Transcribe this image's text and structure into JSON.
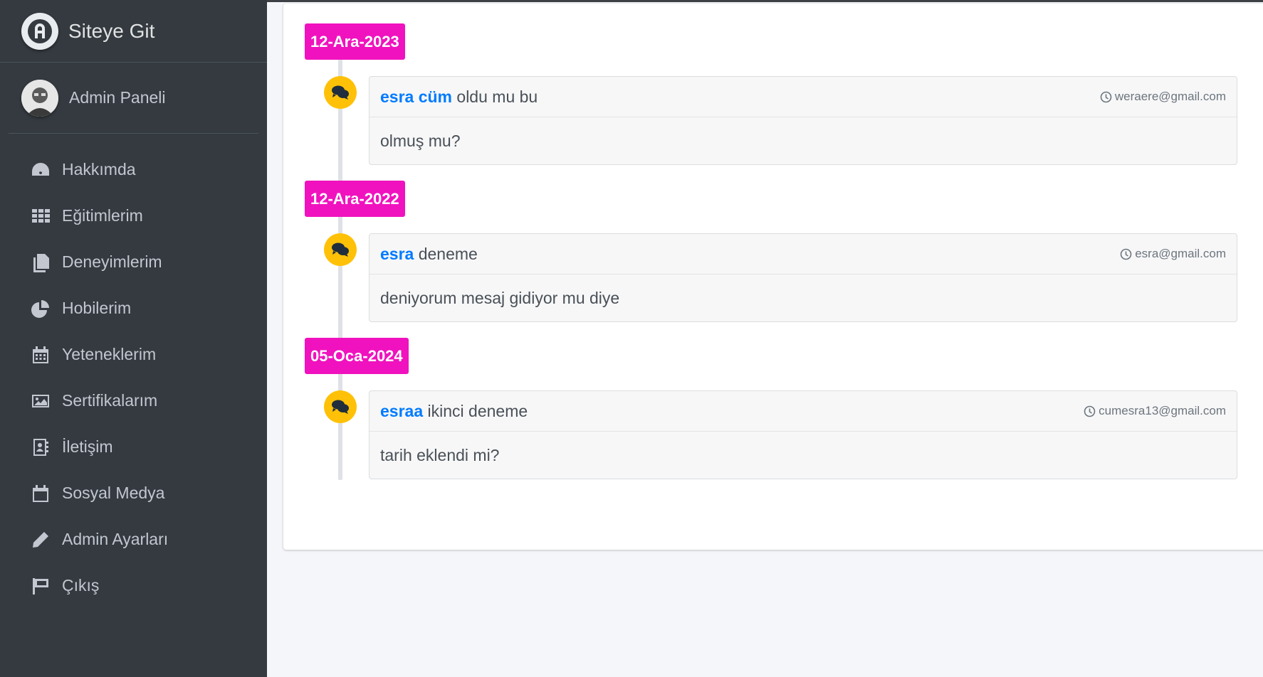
{
  "brand": {
    "title": "Siteye Git"
  },
  "user": {
    "name": "Admin Paneli"
  },
  "nav": [
    {
      "label": "Hakkımda",
      "icon": "tachometer-icon"
    },
    {
      "label": "Eğitimlerim",
      "icon": "grid-icon"
    },
    {
      "label": "Deneyimlerim",
      "icon": "copy-icon"
    },
    {
      "label": "Hobilerim",
      "icon": "pie-chart-icon"
    },
    {
      "label": "Yeteneklerim",
      "icon": "calendar-grid-icon"
    },
    {
      "label": "Sertifikalarım",
      "icon": "image-icon"
    },
    {
      "label": "İletişim",
      "icon": "address-book-icon"
    },
    {
      "label": "Sosyal Medya",
      "icon": "calendar-icon"
    },
    {
      "label": "Admin Ayarları",
      "icon": "pencil-icon"
    },
    {
      "label": "Çıkış",
      "icon": "flag-icon"
    }
  ],
  "timeline": [
    {
      "date": "12-Ara-2023",
      "name": "esra cüm",
      "subject": "oldu mu bu",
      "email": "weraere@gmail.com",
      "message": "olmuş mu?"
    },
    {
      "date": "12-Ara-2022",
      "name": "esra",
      "subject": "deneme",
      "email": "esra@gmail.com",
      "message": "deniyorum mesaj gidiyor mu diye"
    },
    {
      "date": "05-Oca-2024",
      "name": "esraa",
      "subject": "ikinci deneme",
      "email": "cumesra13@gmail.com",
      "message": "tarih eklendi mi?"
    }
  ],
  "colors": {
    "sidebar_bg": "#343a40",
    "date_label": "#f012be",
    "bubble": "#ffc107",
    "name_link": "#007bff"
  }
}
